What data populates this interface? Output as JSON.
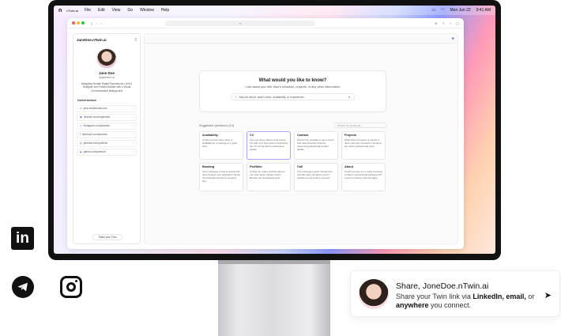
{
  "menubar": {
    "logo": "n",
    "app_name": "nTwin.ai",
    "items": [
      "File",
      "Edit",
      "View",
      "Go",
      "Window",
      "Help"
    ],
    "date": "Mon Jun 22",
    "time": "9:41 AM"
  },
  "browser": {
    "url": "a"
  },
  "sidebar": {
    "title": "JaneDoe.nTwin.ai",
    "name": "Jane Doe",
    "handle": "@janedoe.ai",
    "bio": "Designing Human Digital Experiences | UI/UX Designer and Product Builder with a Visual Communication Background",
    "section_title": "Useful actions",
    "links": [
      "jane.doe@email.com",
      "linkedin.com/in/janedoe",
      "instagram.com/janedoe",
      "facebook.com/janedoe",
      "janedoe.com/portfolio",
      "github.com/janedoe"
    ],
    "share_label": "Share your Twin"
  },
  "main": {
    "ask_title": "What would you like to know?",
    "ask_sub": "I can assist you with Jane's schedule, projects, or any other information.",
    "input_placeholder": "Ask me about Jane's work, availability, or experience...",
    "suggested_label": "Suggested Questions (13)",
    "search_placeholder": "Search for questions...",
    "cards": [
      {
        "t": "Availability",
        "d": "I'd like to know when Jane is available for a meeting or a quick chat."
      },
      {
        "t": "CV",
        "d": "Can you share Jane's most recent CV with me? Get a link to download the CV for the latest professional details."
      },
      {
        "t": "Contact",
        "d": "Would it be possible to get in touch with Jane directly? Find her preferred professional contact details."
      },
      {
        "t": "Projects",
        "d": "What kind of projects or clients is Jane currently involved in? Explore her active professional work."
      },
      {
        "t": "Booking",
        "d": "Can I schedule a time to speak with Jane through your assistant? Check the schedule and find a meeting slot."
      },
      {
        "t": "Portfolio",
        "d": "Is there an online portfolio where I can view Jane's design work? Browse her showcased work."
      },
      {
        "t": "Call",
        "d": "Can I arrange a short introductory call with Jane sometime soon? Quickly set up a call to connect."
      },
      {
        "t": "About",
        "d": "Could you give me a quick overview of Jane's professional background? Learn her history and strengths."
      }
    ]
  },
  "share_card": {
    "title": "Share, JoneDoe.nTwin.ai",
    "desc_1": "Share your Twin link via ",
    "bold_1": "LinkedIn, email,",
    "desc_2": " or ",
    "bold_2": "anywhere",
    "desc_3": " you connect."
  },
  "social": {
    "linkedin": "in"
  }
}
